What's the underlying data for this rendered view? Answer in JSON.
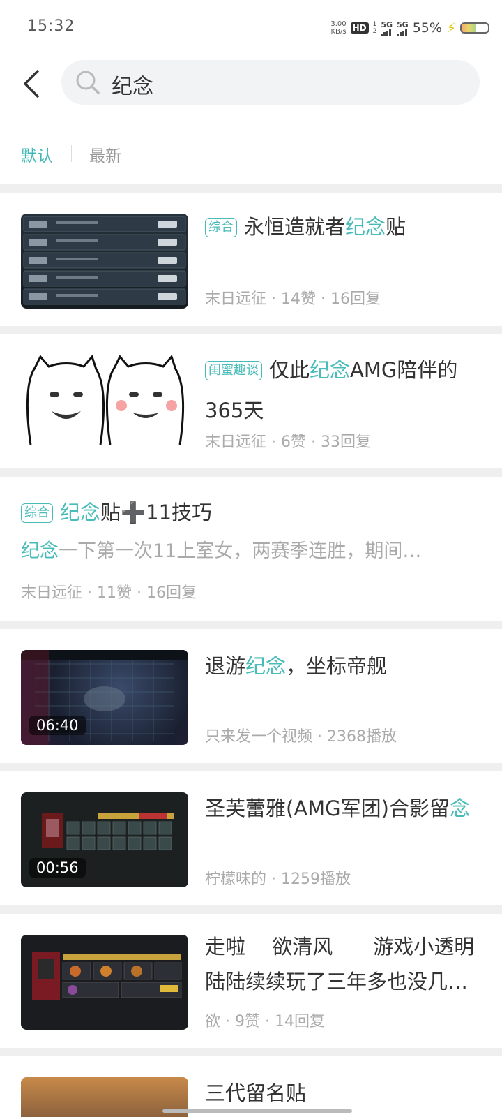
{
  "status_bar": {
    "time": "15:32",
    "net_speed_value": "3.00",
    "net_speed_unit": "KB/s",
    "hd_label": "HD",
    "sim_numbers": "1\n2",
    "signal_1_label": "5G",
    "signal_2_label": "5G",
    "battery_percent": "55%",
    "battery_level": 0.55
  },
  "header": {
    "search_query": "纪念"
  },
  "sort_tabs": {
    "default_label": "默认",
    "latest_label": "最新",
    "active": "default"
  },
  "results": [
    {
      "type": "post",
      "tag": "综合",
      "title_before": "永恒造就者",
      "title_highlight": "纪念",
      "title_after": "贴",
      "meta": "末日远征 · 14赞 · 16回复"
    },
    {
      "type": "post",
      "tag": "闺蜜趣谈",
      "title_before": "仅此",
      "title_highlight": "纪念",
      "title_after": "AMG陪伴的365天",
      "meta": "末日远征 · 6赞 · 33回复"
    },
    {
      "type": "text-post",
      "tag": "综合",
      "title_highlight": "纪念",
      "title_after": "贴➕11技巧",
      "excerpt_highlight": "纪念",
      "excerpt_after": "一下第一次11上室女，两赛季连胜，期间…",
      "meta": "末日远征 · 11赞 · 16回复"
    },
    {
      "type": "video",
      "duration": "06:40",
      "title_before": "退游",
      "title_highlight": "纪念",
      "title_after": "，坐标帝舰",
      "meta": "只来发一个视频 · 2368播放"
    },
    {
      "type": "video",
      "duration": "00:56",
      "title_before": "圣芙蕾雅(AMG军团)合影留",
      "title_highlight": "念",
      "title_after": "",
      "meta": "柠檬味的 · 1259播放"
    },
    {
      "type": "post",
      "title_line1": "走啦　 欲清风　　游戏小透明",
      "title_line2": "陆陆续续玩了三年多也没几…",
      "meta": "欲 · 9赞 · 14回复"
    },
    {
      "type": "post",
      "title_partial": "三代留名贴"
    }
  ],
  "colors": {
    "accent": "#49bcb9",
    "meta_text": "#aaaaaa",
    "divider": "#efefef"
  }
}
